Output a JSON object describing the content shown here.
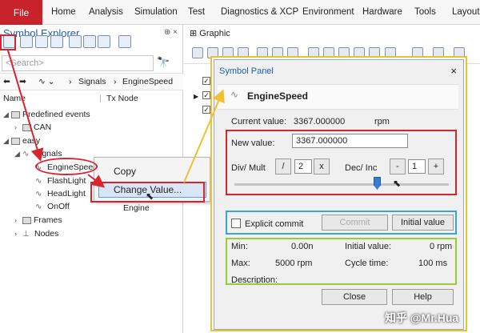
{
  "menubar": {
    "file": "File",
    "items": [
      "Home",
      "Analysis",
      "Simulation",
      "Test",
      "Diagnostics & XCP",
      "Environment",
      "Hardware",
      "Tools",
      "Layout"
    ]
  },
  "symbol_explorer": {
    "title": "Symbol Explorer",
    "pin": "⊕ ×",
    "search_placeholder": "<Search>",
    "nav_path": [
      "Signals",
      "EngineSpeed"
    ],
    "col_name": "Name",
    "col_txnode": "Tx Node",
    "tree": {
      "predefined_events": "Predefined events",
      "can": "CAN",
      "easy": "easy",
      "signals": "Signals",
      "engine_speed": "EngineSpeed",
      "flash_light": "FlashLight",
      "head_light": "HeadLight",
      "on_off": "OnOff",
      "tx_node": "Engine",
      "frames": "Frames",
      "nodes": "Nodes"
    }
  },
  "context_menu": {
    "copy": "Copy",
    "change_value": "Change Value..."
  },
  "graphic": {
    "tab": "Graphic"
  },
  "symbol_panel": {
    "title": "Symbol Panel",
    "close": "×",
    "signal_name": "EngineSpeed",
    "current_value_label": "Current value:",
    "current_value": "3367.000000",
    "unit": "rpm",
    "new_value_label": "New value:",
    "new_value": "3367.000000",
    "div_mult_label": "Div/ Mult",
    "div_btn": "/",
    "div_value": "2",
    "mult_btn": "x",
    "dec_inc_label": "Dec/ Inc",
    "dec_btn": "-",
    "inc_value": "1",
    "inc_btn": "+",
    "slider_fraction": 0.66,
    "explicit_commit": "Explicit commit",
    "commit": "Commit",
    "initial_value_btn": "Initial value",
    "min_label": "Min:",
    "min_value": "0.00n",
    "initial_value_label": "Initial value:",
    "initial_value": "0 rpm",
    "max_label": "Max:",
    "max_value": "5000 rpm",
    "cycle_time_label": "Cycle time:",
    "cycle_time": "100 ms",
    "description_label": "Description:",
    "close_btn": "Close",
    "help_btn": "Help"
  },
  "watermark": "知乎 @Mr.Hua",
  "colors": {
    "file_red": "#c8232c",
    "highlight_red": "#d9232d",
    "highlight_blue": "#3aa3d8",
    "highlight_green": "#9bcb3b",
    "highlight_yellow": "#f0c030",
    "title_blue": "#1c5fa8"
  }
}
